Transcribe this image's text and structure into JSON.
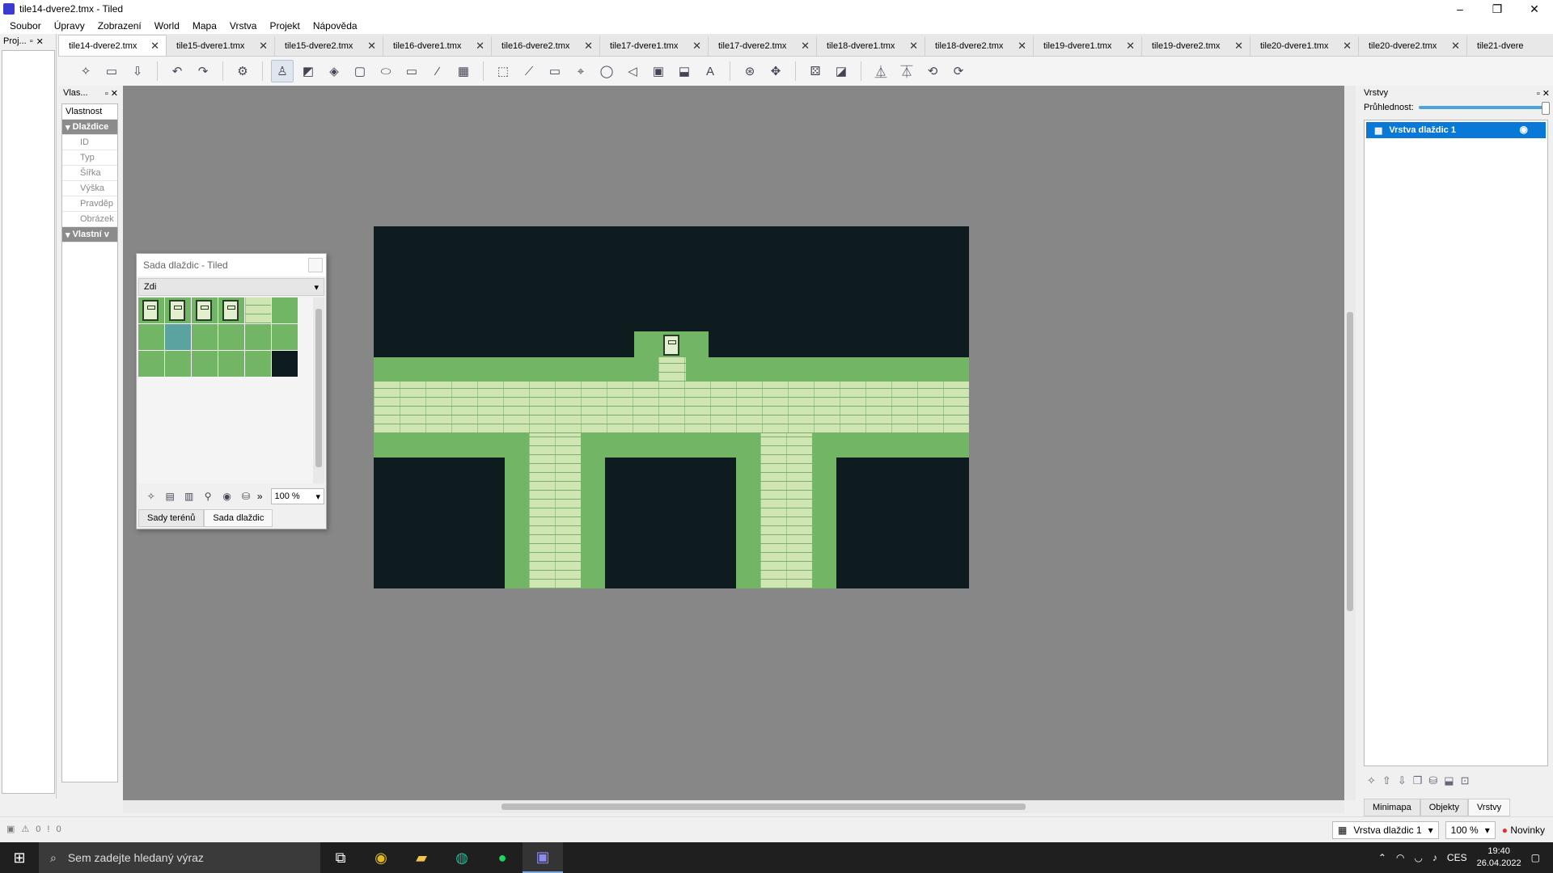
{
  "window": {
    "title": "tile14-dvere2.tmx - Tiled",
    "minimize": "–",
    "maximize": "❐",
    "close": "✕"
  },
  "menu": [
    "Soubor",
    "Úpravy",
    "Zobrazení",
    "World",
    "Mapa",
    "Vrstva",
    "Projekt",
    "Nápověda"
  ],
  "project_dock": {
    "title": "Proj..."
  },
  "tabs": [
    "tile14-dvere2.tmx",
    "tile15-dvere1.tmx",
    "tile15-dvere2.tmx",
    "tile16-dvere1.tmx",
    "tile16-dvere2.tmx",
    "tile17-dvere1.tmx",
    "tile17-dvere2.tmx",
    "tile18-dvere1.tmx",
    "tile18-dvere2.tmx",
    "tile19-dvere1.tmx",
    "tile19-dvere2.tmx",
    "tile20-dvere1.tmx",
    "tile20-dvere2.tmx",
    "tile21-dvere"
  ],
  "properties": {
    "title": "Vlas...",
    "column": "Vlastnost",
    "group1": "Dlaždice",
    "rows": [
      "ID",
      "Typ",
      "Šířka",
      "Výška",
      "Pravděp",
      "Obrázek"
    ],
    "group2": "Vlastní v"
  },
  "tileset": {
    "title": "Sada dlaždic - Tiled",
    "selected": "Zdi",
    "zoom": "100 %",
    "tabs": [
      "Sady terénů",
      "Sada dlaždic"
    ]
  },
  "layers": {
    "title": "Vrstvy",
    "opacity_label": "Průhlednost:",
    "opacity": 1.0,
    "layer_name": "Vrstva dlaždic 1",
    "tabs": [
      "Minimapa",
      "Objekty",
      "Vrstvy"
    ]
  },
  "status": {
    "warn": "0",
    "err": "0",
    "layer": "Vrstva dlaždic 1",
    "zoom": "100 %",
    "news": "Novinky"
  },
  "taskbar": {
    "search_placeholder": "Sem zadejte hledaný výraz",
    "lang": "CES",
    "time": "19:40",
    "date": "26.04.2022"
  },
  "colors": {
    "map_bg": "#0e1b1f",
    "grass": "#72b565",
    "wall": "#cfe6b3",
    "selection": "#0a78d7"
  }
}
